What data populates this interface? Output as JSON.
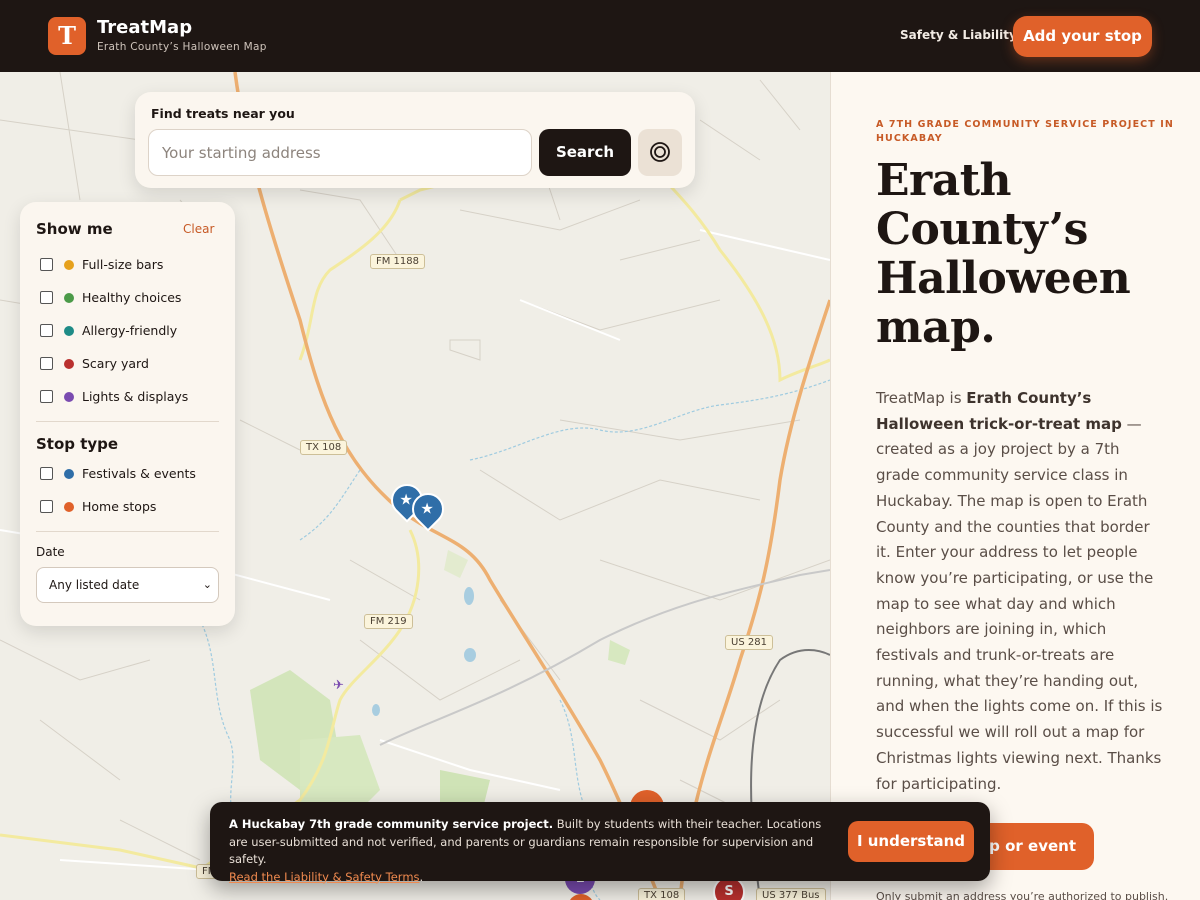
{
  "header": {
    "logo_letter": "T",
    "brand_name": "TreatMap",
    "brand_subtitle": "Erath County’s Halloween Map",
    "nav_link": "Safety & Liability",
    "add_button": "Add your stop"
  },
  "search": {
    "title": "Find treats near you",
    "placeholder": "Your starting address",
    "button": "Search",
    "locate_icon": "target-icon"
  },
  "filters": {
    "heading": "Show me",
    "clear": "Clear",
    "show_items": [
      {
        "label": "Full-size bars",
        "color": "#e6a11c"
      },
      {
        "label": "Healthy choices",
        "color": "#4b9a48"
      },
      {
        "label": "Allergy-friendly",
        "color": "#1e8b86"
      },
      {
        "label": "Scary yard",
        "color": "#b9302e"
      },
      {
        "label": "Lights & displays",
        "color": "#7a4bb0"
      }
    ],
    "stop_type_heading": "Stop type",
    "stop_types": [
      {
        "label": "Festivals & events",
        "color": "#2f6ea8"
      },
      {
        "label": "Home stops",
        "color": "#e0612a"
      }
    ],
    "date_label": "Date",
    "date_value": "Any listed date"
  },
  "map": {
    "road_labels": [
      "FM 1188",
      "TX 108",
      "FM 219",
      "US 281",
      "FM",
      "TX 108",
      "US 377 Bus"
    ],
    "markers": [
      {
        "type": "festival",
        "icon": "star-icon",
        "color": "#2f6ea8"
      },
      {
        "type": "festival",
        "icon": "star-icon",
        "color": "#2f6ea8"
      },
      {
        "type": "home",
        "letter": "",
        "color": "#e0612a"
      },
      {
        "type": "lights",
        "letter": "L",
        "color": "#7a4bb0"
      },
      {
        "type": "scary",
        "letter": "S",
        "color": "#b9302e"
      }
    ]
  },
  "panel": {
    "kicker": "A 7TH GRADE COMMUNITY SERVICE PROJECT IN HUCKABAY",
    "title": "Erath County’s Halloween map.",
    "intro_lead": "TreatMap is ",
    "intro_bold": "Erath County’s Halloween trick-or-treat map",
    "intro_rest": " — created as a joy project by a 7th grade community service class in Huckabay. The map is open to Erath County and the counties that border it. Enter your address to let people know you’re participating, or use the map to see what day and which neighbors are joining in, which festivals and trunk-or-treats are running, what they’re handing out, and when the lights come on. If this is successful we will roll out a map for Christmas lights viewing next. Thanks for participating.",
    "cta_visible": "op or event",
    "fine_print": "Only submit an address you’re authorized to publish."
  },
  "banner": {
    "bold": "A Huckabay 7th grade community service project.",
    "text": " Built by students with their teacher. Locations are user-submitted and not verified, and parents or guardians remain responsible for supervision and safety.",
    "link": "Read the Liability & Safety Terms",
    "link_after": ".",
    "button": "I understand"
  }
}
